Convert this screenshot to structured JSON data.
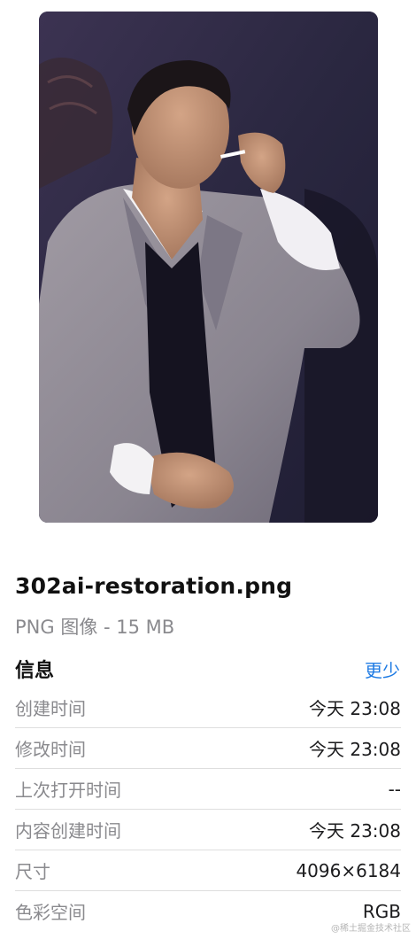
{
  "file": {
    "name": "302ai-restoration.png",
    "meta": "PNG 图像 - 15 MB"
  },
  "info": {
    "title": "信息",
    "toggle_label": "更少",
    "rows": [
      {
        "label": "创建时间",
        "value": "今天 23:08"
      },
      {
        "label": "修改时间",
        "value": "今天 23:08"
      },
      {
        "label": "上次打开时间",
        "value": "--"
      },
      {
        "label": "内容创建时间",
        "value": "今天 23:08"
      },
      {
        "label": "尺寸",
        "value": "4096×6184"
      },
      {
        "label": "色彩空间",
        "value": "RGB"
      }
    ]
  },
  "watermark": "@稀土掘金技术社区"
}
